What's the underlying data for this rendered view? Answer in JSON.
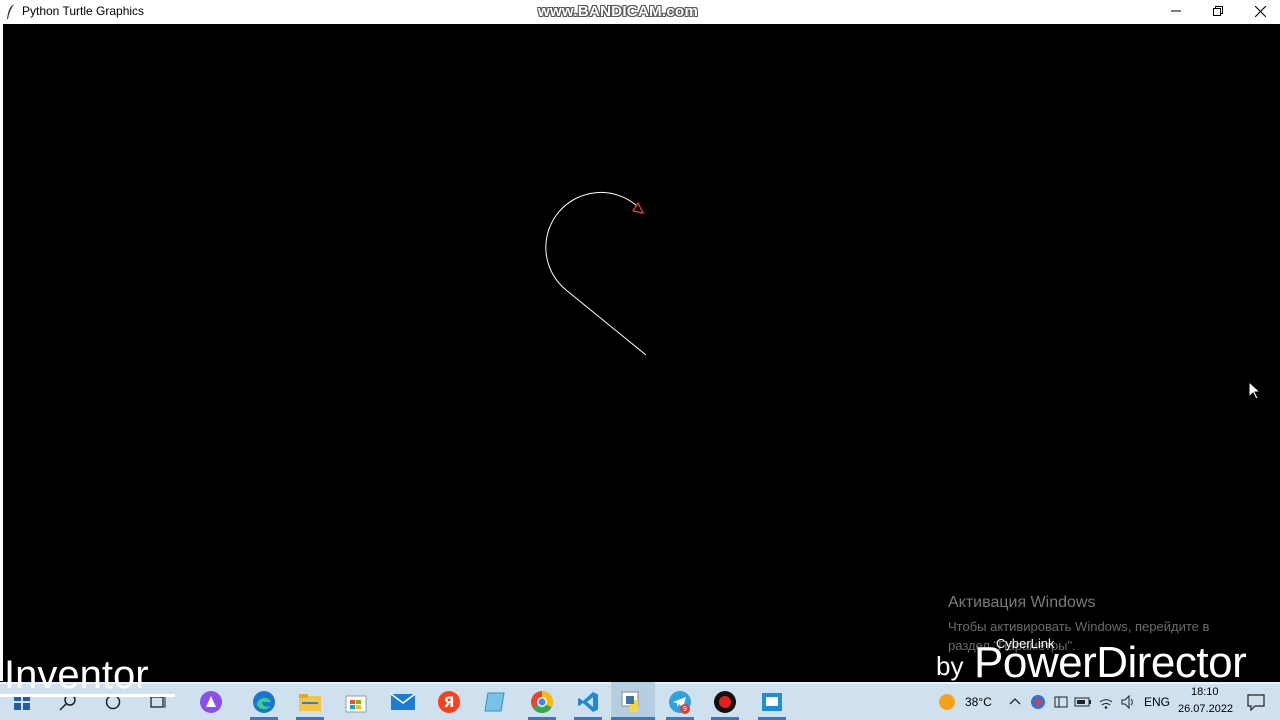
{
  "window": {
    "title": "Python Turtle Graphics",
    "controls": [
      "minimize-icon",
      "restore-icon",
      "close-icon"
    ]
  },
  "recording_watermark": "www.BANDICAM.com",
  "turtle": {
    "pen_color": "#ffffff",
    "turtle_color": "#ff3b3b",
    "background": "#000000"
  },
  "activation": {
    "title": "Активация Windows",
    "line1": "Чтобы активировать Windows, перейдите в",
    "line2": "раздел \"Параметры\"."
  },
  "overlays": {
    "left_caption": "Inventor",
    "brand_small": "CyberLink",
    "brand_by": "by",
    "brand_main": "PowerDirector"
  },
  "taskbar": {
    "pinned": [
      "windows-start-icon",
      "search-icon",
      "cortana-icon",
      "task-view-icon",
      "alice-icon",
      "edge-icon",
      "file-explorer-icon",
      "store-icon",
      "mail-icon",
      "yandex-icon",
      "notepad-icon",
      "chrome-icon",
      "vscode-icon",
      "python-icon",
      "telegram-icon",
      "bandicam-record-icon",
      "remote-desktop-icon"
    ],
    "telegram_badge": "9",
    "weather": "38°C",
    "language": "ENG",
    "time": "18:10",
    "date": "26.07.2022"
  }
}
